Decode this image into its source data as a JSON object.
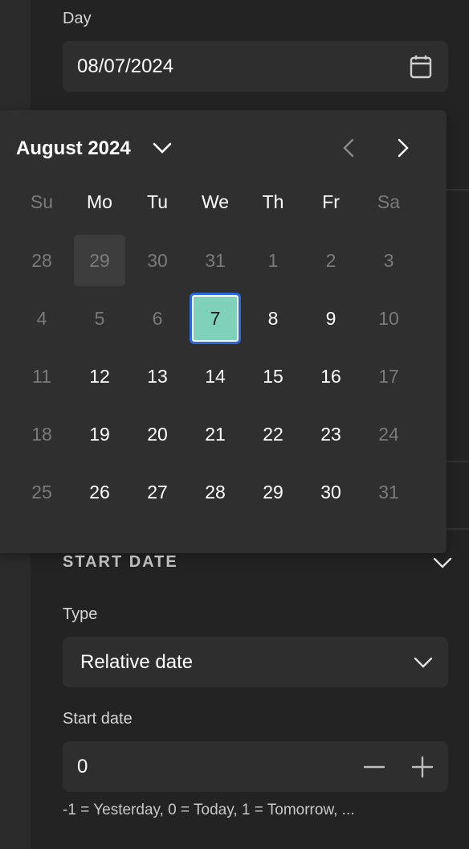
{
  "day_field": {
    "label": "Day",
    "value": "08/07/2024",
    "icon": "calendar-icon"
  },
  "calendar": {
    "month_label": "August 2024",
    "weekdays": [
      "Su",
      "Mo",
      "Tu",
      "We",
      "Th",
      "Fr",
      "Sa"
    ],
    "weeks": [
      [
        "28",
        "29",
        "30",
        "31",
        "1",
        "2",
        "3"
      ],
      [
        "4",
        "5",
        "6",
        "7",
        "8",
        "9",
        "10"
      ],
      [
        "11",
        "12",
        "13",
        "14",
        "15",
        "16",
        "17"
      ],
      [
        "18",
        "19",
        "20",
        "21",
        "22",
        "23",
        "24"
      ],
      [
        "25",
        "26",
        "27",
        "28",
        "29",
        "30",
        "31"
      ]
    ],
    "selected_day": "7",
    "selected_color": "#7fd1b9",
    "accent_border": "#2c6bd6"
  },
  "start_date_section": {
    "title": "START DATE",
    "type_label": "Type",
    "type_value": "Relative date",
    "start_label": "Start date",
    "start_value": "0",
    "hint": "-1 = Yesterday, 0 = Today, 1 = Tomorrow, ..."
  }
}
